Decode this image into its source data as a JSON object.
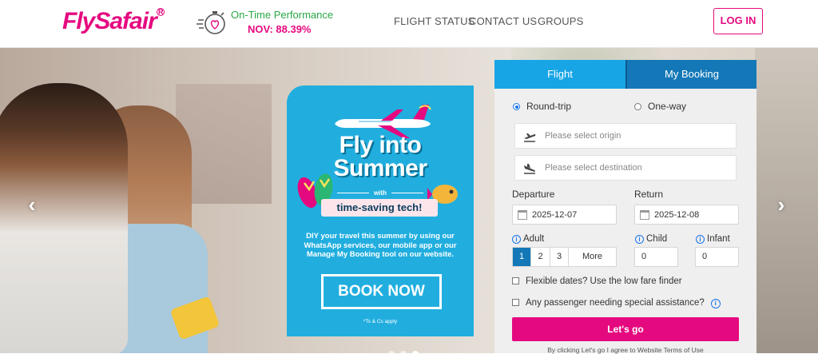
{
  "header": {
    "logo_text_fly": "Fly",
    "logo_text_safair": "Safair",
    "logo_mark": "R",
    "otp_icon": "stopwatch-heart-icon",
    "otp_label": "On-Time Performance",
    "otp_value": "NOV: 88.39%",
    "nav": [
      "FLIGHT STATUS",
      "CONTACT US",
      "GROUPS"
    ],
    "login_label": "LOG IN"
  },
  "hero": {
    "arrow_left": "‹",
    "arrow_right": "›",
    "slide_count": 3,
    "active_slide": 3
  },
  "promo": {
    "title_line1": "Fly into",
    "title_line2": "Summer",
    "with_label": "with",
    "tag": "time-saving tech!",
    "body": "DIY your travel this summer by using our WhatsApp services, our mobile app or our Manage My Booking tool on our website.",
    "button": "BOOK NOW",
    "terms": "*Ts & Cs apply"
  },
  "booking": {
    "tabs": [
      "Flight",
      "My Booking"
    ],
    "active_tab": "Flight",
    "trip_types": [
      "Round-trip",
      "One-way"
    ],
    "selected_trip": "Round-trip",
    "origin_placeholder": "Please select origin",
    "destination_placeholder": "Please select destination",
    "departure_label": "Departure",
    "return_label": "Return",
    "departure_date": "2025-12-07",
    "return_date": "2025-12-08",
    "adult_label": "Adult",
    "child_label": "Child",
    "infant_label": "Infant",
    "adult_options": [
      "1",
      "2",
      "3",
      "More"
    ],
    "adult_selected": "1",
    "child_value": "0",
    "infant_value": "0",
    "flexible_label": "Flexible dates? Use the low fare finder",
    "assistance_label": "Any passenger needing special assistance?",
    "submit_label": "Let's go",
    "terms_text": "By clicking Let's go I agree to Website Terms of Use"
  },
  "colors": {
    "brand_pink": "#e5097f",
    "brand_blue": "#17a5e6",
    "tab_dark_blue": "#1478b8",
    "otp_green": "#2aa845",
    "promo_blue": "#21aedf"
  }
}
